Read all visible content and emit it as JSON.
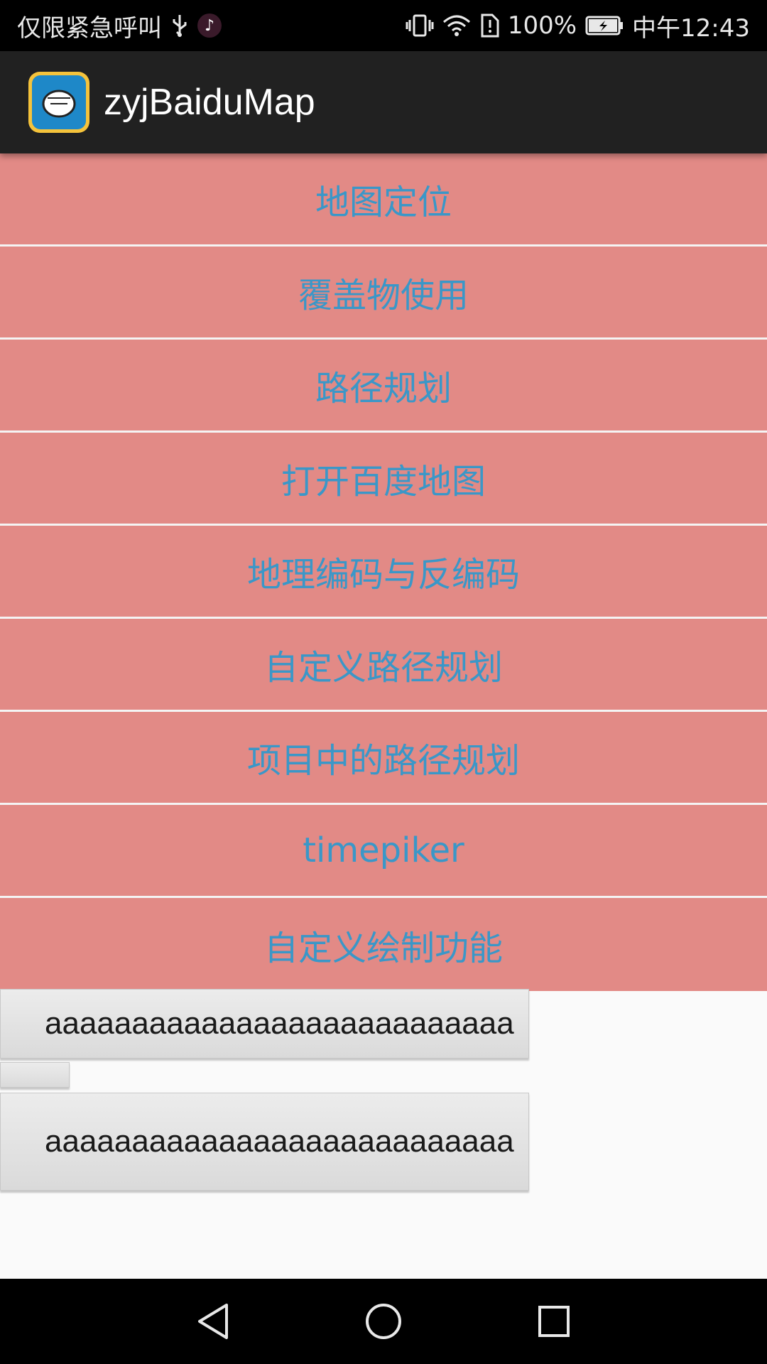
{
  "status_bar": {
    "carrier_text": "仅限紧急呼叫",
    "battery_percent": "100%",
    "time": "中午12:43"
  },
  "action_bar": {
    "title": "zyjBaiduMap"
  },
  "menu": {
    "items": [
      {
        "label": "地图定位"
      },
      {
        "label": "覆盖物使用"
      },
      {
        "label": "路径规划"
      },
      {
        "label": "打开百度地图"
      },
      {
        "label": "地理编码与反编码"
      },
      {
        "label": "自定义路径规划"
      },
      {
        "label": "项目中的路径规划"
      },
      {
        "label": "timepiker"
      },
      {
        "label": "自定义绘制功能"
      }
    ]
  },
  "buttons": {
    "first_label": "aaaaaaaaaaaaaaaaaaaaaaaaaaa",
    "small_label": "",
    "second_label": "aaaaaaaaaaaaaaaaaaaaaaaaaaa"
  },
  "colors": {
    "menu_bg": "#e28a86",
    "menu_text": "#3a97c8",
    "action_bar_bg": "#212121"
  }
}
